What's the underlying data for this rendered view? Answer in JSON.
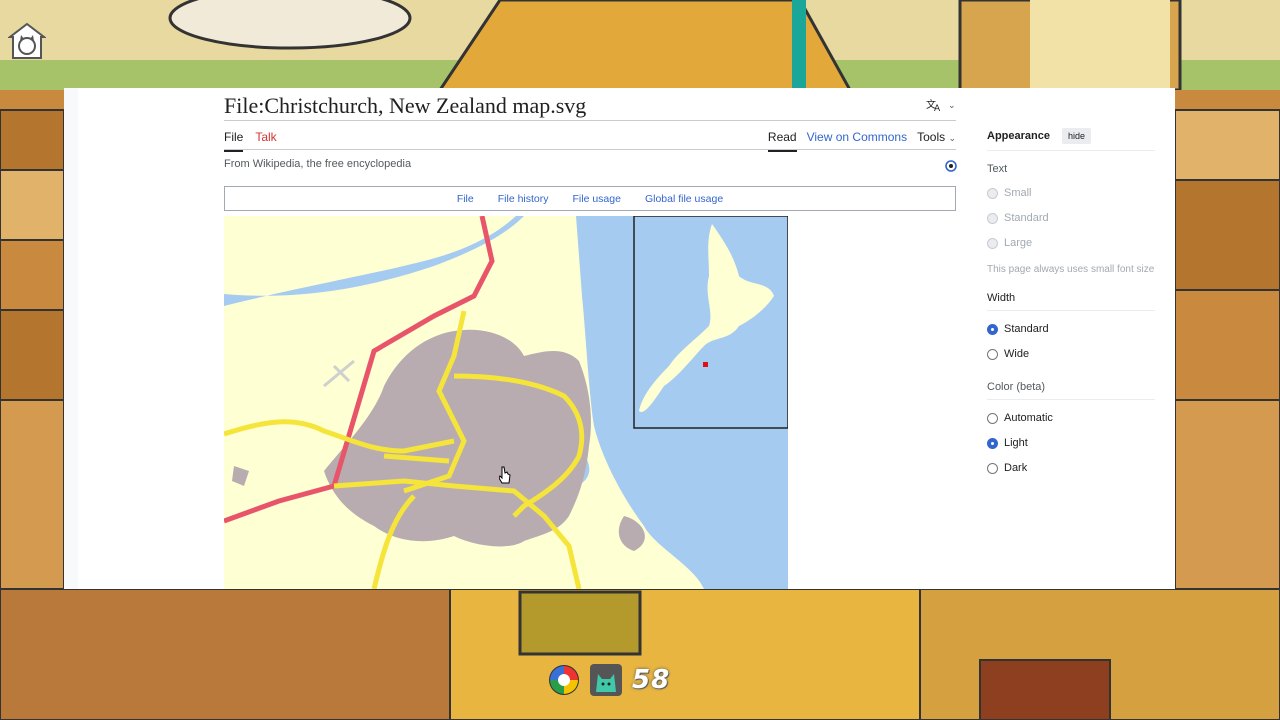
{
  "page": {
    "title": "File:Christchurch, New Zealand map.svg",
    "tabs_left": [
      {
        "label": "File",
        "active": true
      },
      {
        "label": "Talk",
        "active": false
      }
    ],
    "tabs_right": [
      "Read",
      "View on Commons",
      "Tools"
    ],
    "tagline": "From Wikipedia, the free encyclopedia",
    "file_tabs": [
      "File",
      "File history",
      "File usage",
      "Global file usage"
    ]
  },
  "appearance": {
    "heading": "Appearance",
    "hide_label": "hide",
    "text_section": "Text",
    "text_options": [
      "Small",
      "Standard",
      "Large"
    ],
    "text_note": "This page always uses small font size",
    "width_section": "Width",
    "width_options": [
      {
        "label": "Standard",
        "selected": true
      },
      {
        "label": "Wide",
        "selected": false
      }
    ],
    "color_section": "Color (beta)",
    "color_options": [
      {
        "label": "Automatic",
        "selected": false
      },
      {
        "label": "Light",
        "selected": true
      },
      {
        "label": "Dark",
        "selected": false
      }
    ]
  },
  "hud": {
    "count": "58"
  },
  "colors": {
    "link": "#3366cc",
    "talk_red": "#d73333",
    "map_land": "#ffffd4",
    "map_water": "#a6cbf0",
    "map_urban": "#b8acb0",
    "map_road_yellow": "#f5e43a",
    "map_road_red": "#e8556a"
  },
  "icons": [
    "home-cat-icon",
    "translate-icon",
    "chevron-down-icon",
    "refresh-icon",
    "color-wheel-icon",
    "cat-icon",
    "cursor-icon"
  ]
}
